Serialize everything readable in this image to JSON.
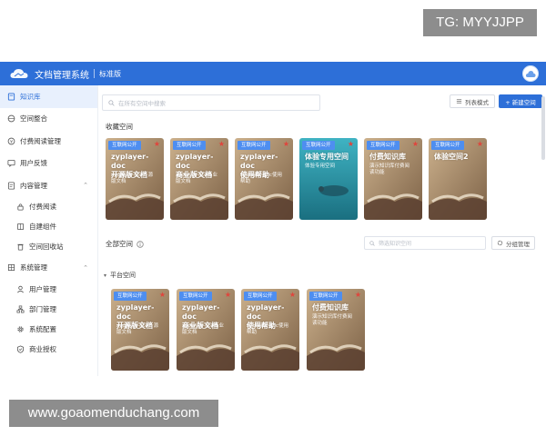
{
  "watermark_top": "TG: MYYJJPP",
  "watermark_bottom": "www.goaomenduchang.com",
  "header": {
    "app_title": "文档管理系统",
    "edition": "标准版"
  },
  "sidebar": {
    "items": [
      {
        "label": "知识库"
      },
      {
        "label": "空间整合"
      },
      {
        "label": "付费阅读管理"
      },
      {
        "label": "用户反馈"
      },
      {
        "label": "内容管理"
      },
      {
        "label": "付费阅读"
      },
      {
        "label": "自建组件"
      },
      {
        "label": "空间回收站"
      },
      {
        "label": "系统管理"
      },
      {
        "label": "用户管理"
      },
      {
        "label": "部门管理"
      },
      {
        "label": "系统配置"
      },
      {
        "label": "商业授权"
      }
    ]
  },
  "toolbar": {
    "search_placeholder": "在所有空间中搜索",
    "list_mode": "列表模式",
    "new_space": "+ 新建空间"
  },
  "favorites": {
    "title": "收藏空间",
    "cards": [
      {
        "tag": "互联网公开",
        "title": "zyplayer-doc\n开源版文档",
        "desc": "zyplayer-doc开源\n版文档"
      },
      {
        "tag": "互联网公开",
        "title": "zyplayer-doc\n商业版文档",
        "desc": "zyplayer-doc商业\n版文档"
      },
      {
        "tag": "互联网公开",
        "title": "zyplayer-doc\n使用帮助",
        "desc": "zyplayer-doc使用\n帮助"
      },
      {
        "tag": "互联网公开",
        "title": "体验专用空间",
        "desc": "体验专用空间"
      },
      {
        "tag": "互联网公开",
        "title": "付费知识库",
        "desc": "演示知识库付费阅\n读功能"
      },
      {
        "tag": "互联网公开",
        "title": "体验空间2",
        "desc": ""
      }
    ]
  },
  "all_spaces": {
    "title": "全部空间",
    "filter_placeholder": "筛选知识空间",
    "group_manage": "分组管理",
    "group_name": "平台空间",
    "cards": [
      {
        "tag": "互联网公开",
        "title": "zyplayer-doc\n开源版文档",
        "desc": "zyplayer-doc开源\n版文档"
      },
      {
        "tag": "互联网公开",
        "title": "zyplayer-doc\n商业版文档",
        "desc": "zyplayer-doc商业\n版文档"
      },
      {
        "tag": "互联网公开",
        "title": "zyplayer-doc\n使用帮助",
        "desc": "zyplayer-doc使用\n帮助"
      },
      {
        "tag": "互联网公开",
        "title": "付费知识库",
        "desc": "演示知识库付费阅\n读功能"
      }
    ]
  },
  "colors": {
    "accent": "#2d6fd8",
    "tag": "#4e8ef0",
    "star": "#e0443c"
  }
}
